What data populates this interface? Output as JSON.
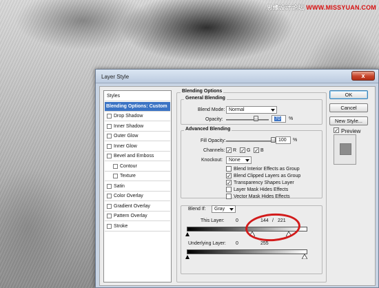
{
  "watermark": {
    "prefix": "思缘设计论坛 ",
    "site": "WWW.MISSYUAN.COM"
  },
  "dialog": {
    "title": "Layer Style",
    "close_glyph": "x"
  },
  "styles_list": {
    "header": "Styles",
    "items": [
      {
        "label": "Blending Options: Custom",
        "selected": true
      },
      {
        "label": "Drop Shadow",
        "checked": false
      },
      {
        "label": "Inner Shadow",
        "checked": false
      },
      {
        "label": "Outer Glow",
        "checked": false
      },
      {
        "label": "Inner Glow",
        "checked": false
      },
      {
        "label": "Bevel and Emboss",
        "checked": false
      },
      {
        "label": "Contour",
        "checked": false,
        "sub": true
      },
      {
        "label": "Texture",
        "checked": false,
        "sub": true
      },
      {
        "label": "Satin",
        "checked": false
      },
      {
        "label": "Color Overlay",
        "checked": false
      },
      {
        "label": "Gradient Overlay",
        "checked": false
      },
      {
        "label": "Pattern Overlay",
        "checked": false
      },
      {
        "label": "Stroke",
        "checked": false
      }
    ]
  },
  "blending_options": {
    "title": "Blending Options",
    "general": {
      "title": "General Blending",
      "blend_mode_label": "Blend Mode:",
      "blend_mode_value": "Normal",
      "opacity_label": "Opacity:",
      "opacity_value": "70",
      "opacity_unit": "%",
      "opacity_fraction": 0.7
    },
    "advanced": {
      "title": "Advanced Blending",
      "fill_opacity_label": "Fill Opacity:",
      "fill_opacity_value": "100",
      "fill_opacity_unit": "%",
      "fill_opacity_fraction": 1.0,
      "channels_label": "Channels:",
      "channels": [
        {
          "label": "R",
          "checked": true
        },
        {
          "label": "G",
          "checked": true
        },
        {
          "label": "B",
          "checked": true
        }
      ],
      "knockout_label": "Knockout:",
      "knockout_value": "None",
      "options": [
        {
          "label": "Blend Interior Effects as Group",
          "checked": false
        },
        {
          "label": "Blend Clipped Layers as Group",
          "checked": true
        },
        {
          "label": "Transparency Shapes Layer",
          "checked": true
        },
        {
          "label": "Layer Mask Hides Effects",
          "checked": false
        },
        {
          "label": "Vector Mask Hides Effects",
          "checked": false
        }
      ]
    },
    "blend_if": {
      "label": "Blend If:",
      "value": "Gray",
      "this_layer_label": "This Layer:",
      "this_layer_low": "0",
      "this_layer_mid_a": "144",
      "this_layer_sep": "/",
      "this_layer_mid_b": "221",
      "underlying_label": "Underlying Layer:",
      "underlying_low": "0",
      "underlying_high": "255"
    }
  },
  "buttons": {
    "ok": "OK",
    "cancel": "Cancel",
    "new_style": "New Style...",
    "preview_label": "Preview",
    "preview_checked": true
  },
  "check_glyph": "✓",
  "colors": {
    "selection_blue": "#3b73c4",
    "annotation_red": "#d21b1b",
    "dialog_frame": "#c8d4e4",
    "close_button": "#c8452b"
  }
}
